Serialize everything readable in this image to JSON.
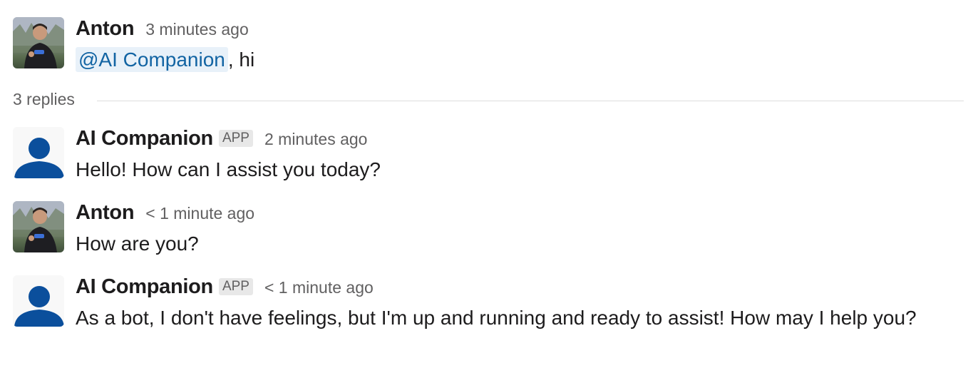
{
  "thread": {
    "root": {
      "author": "Anton",
      "timestamp": "3 minutes ago",
      "mention": "@AI Companion",
      "text_after_mention": ", hi",
      "avatar": "user-photo-avatar"
    },
    "replies_label": "3 replies",
    "replies": [
      {
        "author": "AI Companion",
        "badge": "APP",
        "timestamp": "2 minutes ago",
        "text": "Hello! How can I assist you today?",
        "avatar": "bot-person-icon"
      },
      {
        "author": "Anton",
        "timestamp": "< 1 minute ago",
        "text": "How are you?",
        "avatar": "user-photo-avatar"
      },
      {
        "author": "AI Companion",
        "badge": "APP",
        "timestamp": "< 1 minute ago",
        "text": "As a bot, I don't have feelings, but I'm up and running and ready to assist! How may I help you?",
        "avatar": "bot-person-icon"
      }
    ]
  },
  "colors": {
    "bot_icon": "#0b4f9c",
    "mention_text": "#1264a3",
    "mention_bg": "#e8f1f9",
    "muted_text": "#616061"
  }
}
